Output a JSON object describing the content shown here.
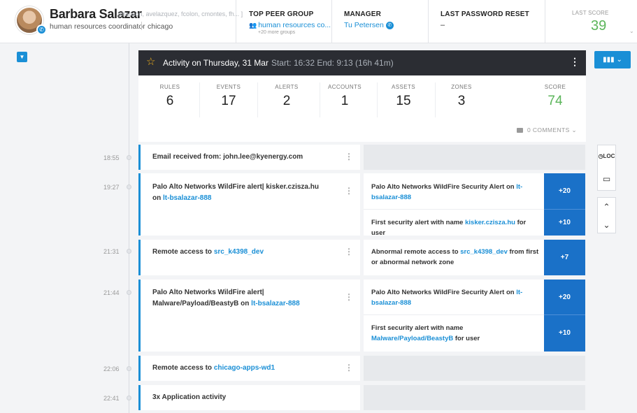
{
  "user": {
    "name": "Barbara Salazar",
    "aliases": "[thanson, avelazquez, fcolon, cmontes, fh... ]",
    "title": "human resources coordinator",
    "location": "chicago"
  },
  "header": {
    "peer_group_label": "TOP PEER GROUP",
    "peer_group_value": "human resources co...",
    "peer_group_more": "+20 more groups",
    "manager_label": "MANAGER",
    "manager_value": "Tu Petersen",
    "password_label": "LAST PASSWORD RESET",
    "password_value": "–",
    "last_score_label": "LAST SCORE",
    "last_score_value": "39"
  },
  "activity": {
    "title": "Activity on Thursday, 31 Mar",
    "range": "Start: 16:32 End: 9:13 (16h 41m)",
    "stats": [
      {
        "label": "RULES",
        "value": "6"
      },
      {
        "label": "EVENTS",
        "value": "17"
      },
      {
        "label": "ALERTS",
        "value": "2"
      },
      {
        "label": "ACCOUNTS",
        "value": "1"
      },
      {
        "label": "ASSETS",
        "value": "15"
      },
      {
        "label": "ZONES",
        "value": "3"
      },
      {
        "label": "SCORE",
        "value": "74"
      }
    ],
    "comments": "0 COMMENTS"
  },
  "tools": {
    "loc": "LOC"
  },
  "events": [
    {
      "time": "18:55",
      "text_prefix": "Email received from: john.lee@kyenergy.com",
      "link": "",
      "text_suffix": ""
    },
    {
      "time": "19:27",
      "text_prefix": "Palo Alto Networks WildFire alert| kisker.czisza.hu on ",
      "link": "lt-bsalazar-888",
      "text_suffix": "",
      "alerts": [
        {
          "prefix": "Palo Alto Networks WildFire Security Alert on ",
          "link": "lt-bsalazar-888",
          "suffix": "",
          "score": "+20"
        },
        {
          "prefix": "First security alert with name ",
          "link": "kisker.czisza.hu",
          "suffix": " for user",
          "score": "+10"
        }
      ]
    },
    {
      "time": "21:31",
      "text_prefix": "Remote access to ",
      "link": "src_k4398_dev",
      "text_suffix": "",
      "alerts": [
        {
          "prefix": "Abnormal remote access to ",
          "link": "src_k4398_dev",
          "suffix": " from first or abnormal network zone",
          "score": "+7"
        }
      ]
    },
    {
      "time": "21:44",
      "text_prefix": "Palo Alto Networks WildFire alert| Malware/Payload/BeastyB on ",
      "link": "lt-bsalazar-888",
      "text_suffix": "",
      "alerts": [
        {
          "prefix": "Palo Alto Networks WildFire Security Alert on ",
          "link": "lt-bsalazar-888",
          "suffix": "",
          "score": "+20"
        },
        {
          "prefix": "First security alert with name ",
          "link": "Malware/Payload/BeastyB",
          "suffix": " for user",
          "score": "+10"
        }
      ]
    },
    {
      "time": "22:06",
      "text_prefix": "Remote access to ",
      "link": "chicago-apps-wd1",
      "text_suffix": ""
    },
    {
      "time": "22:41",
      "text_prefix": "3x Application activity",
      "link": "",
      "text_suffix": ""
    }
  ],
  "colors": {
    "accent": "#1a8fd6",
    "score_green": "#5bb55a",
    "alert_score_bg": "#1a71c8",
    "header_dark": "#2b2d33"
  }
}
